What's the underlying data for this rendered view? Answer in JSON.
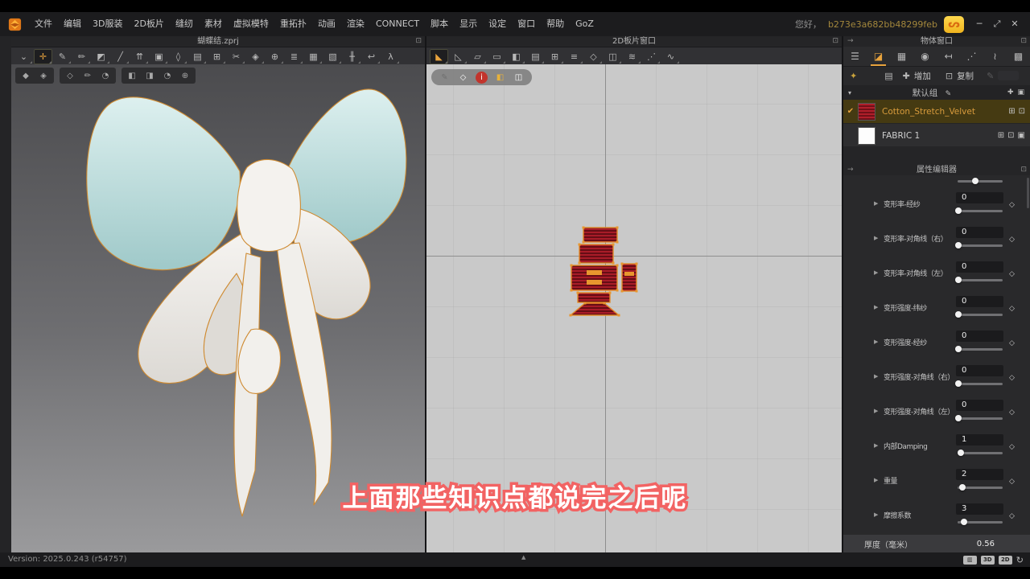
{
  "window": {
    "greeting": "您好，",
    "user_id": "b273e3a682bb48299feb",
    "controls": [
      {
        "name": "minimize-button",
        "glyph": "─"
      },
      {
        "name": "restore-button",
        "glyph": "⤢"
      },
      {
        "name": "close-button",
        "glyph": "✕"
      }
    ]
  },
  "menu": {
    "items": [
      "文件",
      "编辑",
      "3D服装",
      "2D板片",
      "缝纫",
      "素材",
      "虚拟模特",
      "重拓扑",
      "动画",
      "渲染",
      "CONNECT",
      "脚本",
      "显示",
      "设定",
      "窗口",
      "帮助",
      "GoZ"
    ]
  },
  "viewport3d": {
    "title": "蝴蝶结.zprj",
    "float_glyph": "⊡",
    "tools": [
      {
        "name": "show-mode-icon",
        "glyph": "⌄"
      },
      {
        "name": "select-move-icon",
        "glyph": "✛",
        "active": true
      },
      {
        "name": "pen-cursor-icon",
        "glyph": "✎"
      },
      {
        "name": "brush-icon",
        "glyph": "✏"
      },
      {
        "name": "pin-garment-icon",
        "glyph": "◩"
      },
      {
        "name": "line-tool-icon",
        "glyph": "╱"
      },
      {
        "name": "fold-arrange-icon",
        "glyph": "⇈"
      },
      {
        "name": "paste-pattern-icon",
        "glyph": "▣"
      },
      {
        "name": "garment-icon",
        "glyph": "◊"
      },
      {
        "name": "sewing-machine-icon",
        "glyph": "▤"
      },
      {
        "name": "quilt-grid-icon",
        "glyph": "⊞"
      },
      {
        "name": "scissors-icon",
        "glyph": "✂"
      },
      {
        "name": "steam-icon",
        "glyph": "◈"
      },
      {
        "name": "globe-icon",
        "glyph": "⊕"
      },
      {
        "name": "zipper-icon",
        "glyph": "≣"
      },
      {
        "name": "wall-icon",
        "glyph": "▦"
      },
      {
        "name": "wall-select-icon",
        "glyph": "▧"
      },
      {
        "name": "measure-icon",
        "glyph": "╫"
      },
      {
        "name": "hook-icon",
        "glyph": "↩"
      },
      {
        "name": "avatar-walk-icon",
        "glyph": "λ"
      }
    ],
    "quick_groups": [
      [
        {
          "name": "solid-view-icon",
          "glyph": "◆"
        },
        {
          "name": "mesh-view-icon",
          "glyph": "◈"
        }
      ],
      [
        {
          "name": "show-garment-icon",
          "glyph": "◇"
        },
        {
          "name": "texture-paint-icon",
          "glyph": "✏"
        },
        {
          "name": "show-avatar-icon",
          "glyph": "◔"
        }
      ],
      [
        {
          "name": "fabric-view-icon",
          "glyph": "◧"
        },
        {
          "name": "fabric-fold-icon",
          "glyph": "◨"
        },
        {
          "name": "avatar-dim-icon",
          "glyph": "◔"
        },
        {
          "name": "env-globe-icon",
          "glyph": "⊕"
        }
      ]
    ]
  },
  "viewport2d": {
    "title": "2D板片窗口",
    "float_glyph": "⊡",
    "tools": [
      {
        "name": "transform-tool-icon",
        "glyph": "◣",
        "active": true
      },
      {
        "name": "edit-curve-icon",
        "glyph": "◺"
      },
      {
        "name": "pattern-outline-icon",
        "glyph": "▱"
      },
      {
        "name": "rect-tool-icon",
        "glyph": "▭"
      },
      {
        "name": "fabric-piece-icon",
        "glyph": "◧"
      },
      {
        "name": "sewing-machine-icon",
        "glyph": "▤"
      },
      {
        "name": "quilt-icon",
        "glyph": "⊞"
      },
      {
        "name": "iron-icon",
        "glyph": "≡"
      },
      {
        "name": "tshirt-icon",
        "glyph": "◇"
      },
      {
        "name": "steamer-icon",
        "glyph": "◫"
      },
      {
        "name": "pleats-icon",
        "glyph": "≋"
      },
      {
        "name": "baste-icon",
        "glyph": "⋰"
      },
      {
        "name": "elastic-icon",
        "glyph": "∿"
      }
    ],
    "pill_icons": [
      {
        "name": "needle-icon",
        "glyph": "✎",
        "fg": "#6f6f6f",
        "bg": "transparent"
      },
      {
        "name": "tshirt-white-icon",
        "glyph": "◇",
        "fg": "#fafafa",
        "bg": "transparent"
      },
      {
        "name": "info-icon",
        "glyph": "i",
        "fg": "#ffffff",
        "bg": "#c2342c"
      },
      {
        "name": "fabric-yellow-icon",
        "glyph": "◧",
        "fg": "#e8b23a",
        "bg": "transparent"
      },
      {
        "name": "arrange-fabric-icon",
        "glyph": "◫",
        "fg": "#fafafa",
        "bg": "transparent"
      }
    ]
  },
  "object_window": {
    "title": "物体窗口",
    "float_glyph": "⊡",
    "dock_glyph": "→",
    "tabs": [
      {
        "name": "tab-object-list",
        "glyph": "☰"
      },
      {
        "name": "tab-fabric",
        "glyph": "◪",
        "active": true
      },
      {
        "name": "tab-graphic",
        "glyph": "▦"
      },
      {
        "name": "tab-button",
        "glyph": "◉"
      },
      {
        "name": "tab-pin",
        "glyph": "↤"
      },
      {
        "name": "tab-topstitch",
        "glyph": "⋰"
      },
      {
        "name": "tab-puckering",
        "glyph": "≀"
      },
      {
        "name": "tab-scan",
        "glyph": "▩"
      }
    ],
    "actions": {
      "spool_glyph": "✦",
      "import_glyph": "▤",
      "add_icon": "✚",
      "add_label": "增加",
      "copy_icon": "⊡",
      "copy_label": "复制",
      "edit_glyph": "✎"
    },
    "group": {
      "collapse_glyph": "▾",
      "name": "默认组",
      "edit_glyph": "✎",
      "add_glyph": "✚",
      "folder_glyph": "▣"
    },
    "fabrics": [
      {
        "name": "Cotton_Stretch_Velvet",
        "selected": true,
        "swatch": "red-stripes",
        "check": "✔",
        "icons": [
          "⊞",
          "⊡"
        ]
      },
      {
        "name": "FABRIC 1",
        "selected": false,
        "swatch": "white",
        "check": "",
        "icons": [
          "⊞",
          "⊡",
          "▣"
        ]
      }
    ]
  },
  "property_editor": {
    "title": "属性编辑器",
    "float_glyph": "⊡",
    "dock_glyph": "→",
    "partial_slider_pct": 40,
    "rows": [
      {
        "label": "变形率-经纱",
        "value": "0",
        "pct": 2
      },
      {
        "label": "变形率-对角线（右）",
        "value": "0",
        "pct": 2
      },
      {
        "label": "变形率-对角线（左）",
        "value": "0",
        "pct": 2
      },
      {
        "label": "变形强度-纬纱",
        "value": "0",
        "pct": 2
      },
      {
        "label": "变形强度-经纱",
        "value": "0",
        "pct": 2
      },
      {
        "label": "变形强度-对角线（右）",
        "value": "0",
        "pct": 2
      },
      {
        "label": "变形强度-对角线（左）",
        "value": "0",
        "pct": 2
      },
      {
        "label": "内部Damping",
        "value": "1",
        "pct": 8
      },
      {
        "label": "重量",
        "value": "2",
        "pct": 11
      },
      {
        "label": "摩擦系数",
        "value": "3",
        "pct": 14
      }
    ],
    "thickness": {
      "label": "厚度（毫米）",
      "value": "0.56"
    }
  },
  "status_bar": {
    "version": "Version: 2025.0.243 (r54757)",
    "expander_glyph": "▲",
    "buttons": [
      {
        "name": "split-view-button",
        "glyph": "▥",
        "boxed": true
      },
      {
        "name": "view-3d-button",
        "glyph": "3D",
        "boxed": true
      },
      {
        "name": "view-2d-button",
        "glyph": "2D",
        "boxed": true
      },
      {
        "name": "sync-button",
        "glyph": "↻",
        "boxed": false
      }
    ]
  },
  "subtitle": {
    "text": "上面那些知识点都说完之后呢"
  },
  "colors": {
    "accent": "#e8a33d",
    "selected_row": "#453a12",
    "fabric_red": "#a81c28",
    "subtitle_stroke": "#f26363"
  }
}
